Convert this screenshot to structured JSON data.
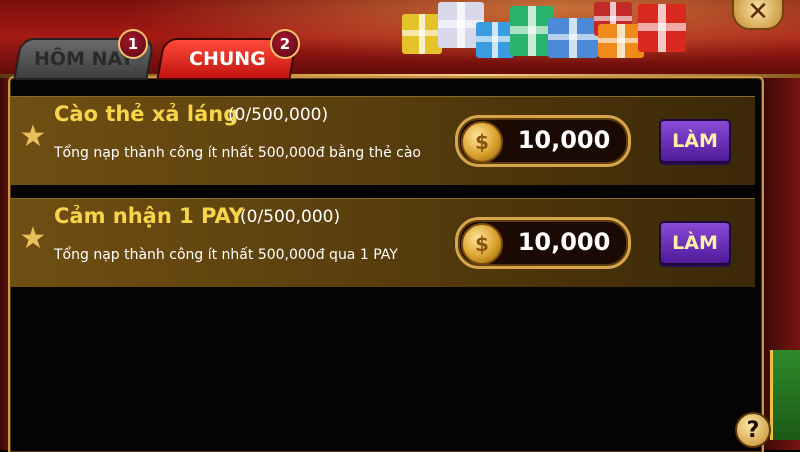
{
  "tabs": [
    {
      "label": "HÔM NAY",
      "badge": "1",
      "active": false
    },
    {
      "label": "CHUNG",
      "badge": "2",
      "active": true
    }
  ],
  "close_icon": "close-x-icon",
  "missions": [
    {
      "title": "Cào thẻ xả láng",
      "progress": "(0/500,000)",
      "description": "Tổng nạp thành công ít nhất 500,000đ bằng thẻ cào",
      "reward_amount": "10,000",
      "reward_icon": "coin-icon",
      "action_label": "LÀM"
    },
    {
      "title": "Cảm nhận 1 PAY",
      "progress": "(0/500,000)",
      "description": "Tổng nạp thành công ít nhất 500,000đ qua 1 PAY",
      "reward_amount": "10,000",
      "reward_icon": "coin-icon",
      "action_label": "LÀM"
    }
  ],
  "help_label": "?",
  "colors": {
    "title_gold": "#f7d54a",
    "active_tab": "#d8201a",
    "action_button": "#6a2fc0",
    "border_gold": "#c8954a"
  }
}
